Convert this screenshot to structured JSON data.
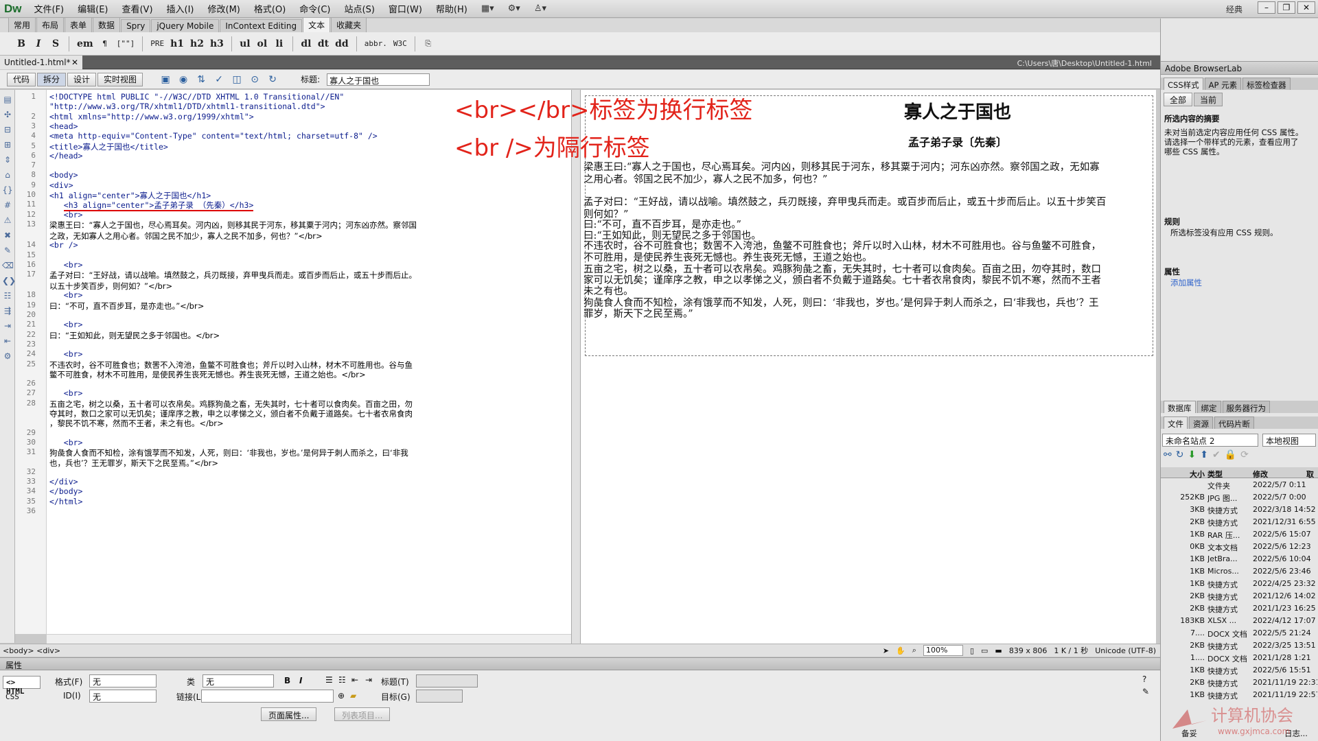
{
  "app": {
    "logo": "Dw",
    "layout": "经典",
    "menus": [
      "文件(F)",
      "编辑(E)",
      "查看(V)",
      "插入(I)",
      "修改(M)",
      "格式(O)",
      "命令(C)",
      "站点(S)",
      "窗口(W)",
      "帮助(H)"
    ]
  },
  "insert_tabs": [
    "常用",
    "布局",
    "表单",
    "数据",
    "Spry",
    "jQuery Mobile",
    "InContext Editing",
    "文本",
    "收藏夹"
  ],
  "format_buttons": [
    "B",
    "I",
    "S",
    "em",
    "¶",
    "[\"\"]",
    "PRE",
    "h1",
    "h2",
    "h3",
    "ul",
    "ol",
    "li",
    "dl",
    "dt",
    "dd",
    "abbr.",
    "W3C",
    "⎘"
  ],
  "document": {
    "tab": "Untitled-1.html*",
    "path": "C:\\Users\\唐\\Desktop\\Untitled-1.html",
    "views": [
      "代码",
      "拆分",
      "设计",
      "实时视图"
    ],
    "title_label": "标题:",
    "title_value": "寡人之于国也"
  },
  "code_lines": [
    {
      "n": "1",
      "t": "<!DOCTYPE html PUBLIC \"-//W3C//DTD XHTML 1.0 Transitional//EN\""
    },
    {
      "n": "",
      "t": "\"http://www.w3.org/TR/xhtml1/DTD/xhtml1-transitional.dtd\">"
    },
    {
      "n": "2",
      "t": "<html xmlns=\"http://www.w3.org/1999/xhtml\">"
    },
    {
      "n": "3",
      "t": "<head>"
    },
    {
      "n": "4",
      "t": "<meta http-equiv=\"Content-Type\" content=\"text/html; charset=utf-8\" />"
    },
    {
      "n": "5",
      "t": "<title>寡人之于国也</title>"
    },
    {
      "n": "6",
      "t": "</head>"
    },
    {
      "n": "7",
      "t": ""
    },
    {
      "n": "8",
      "t": "<body>"
    },
    {
      "n": "9",
      "t": "<div>"
    },
    {
      "n": "10",
      "t": "<h1 align=\"center\">寡人之于国也</h1>"
    },
    {
      "n": "11",
      "t": "<h3 align=\"center\">孟子弟子录 （先秦）</h3>"
    },
    {
      "n": "12",
      "t": "   <br>"
    },
    {
      "n": "13",
      "t": "梁惠王曰：“寡人之于国也，尽心焉耳矣。河内凶，则移其民于河东，移其粟于河内；河东凶亦然。察邻国"
    },
    {
      "n": "",
      "t": "之政，无如寡人之用心者。邻国之民不加少，寡人之民不加多，何也？”</br>"
    },
    {
      "n": "14",
      "t": "<br />"
    },
    {
      "n": "15",
      "t": ""
    },
    {
      "n": "16",
      "t": "   <br>"
    },
    {
      "n": "17",
      "t": "孟子对曰：“王好战，请以战喻。填然鼓之，兵刃既接，弃甲曳兵而走。或百步而后止，或五十步而后止。"
    },
    {
      "n": "",
      "t": "以五十步笑百步，则何如？”</br>"
    },
    {
      "n": "18",
      "t": "   <br>"
    },
    {
      "n": "19",
      "t": "曰：“不可，直不百步耳，是亦走也。”</br>"
    },
    {
      "n": "20",
      "t": ""
    },
    {
      "n": "21",
      "t": "   <br>"
    },
    {
      "n": "22",
      "t": "曰：“王如知此，则无望民之多于邻国也。</br>"
    },
    {
      "n": "23",
      "t": ""
    },
    {
      "n": "24",
      "t": "   <br>"
    },
    {
      "n": "25",
      "t": "不违农时，谷不可胜食也；数罟不入洿池，鱼鳖不可胜食也；斧斤以时入山林，材木不可胜用也。谷与鱼"
    },
    {
      "n": "",
      "t": "鳖不可胜食，材木不可胜用，是使民养生丧死无憾也。养生丧死无憾，王道之始也。</br>"
    },
    {
      "n": "26",
      "t": ""
    },
    {
      "n": "27",
      "t": "   <br>"
    },
    {
      "n": "28",
      "t": "五亩之宅，树之以桑，五十者可以衣帛矣。鸡豚狗彘之畜，无失其时，七十者可以食肉矣。百亩之田，勿"
    },
    {
      "n": "",
      "t": "夺其时，数口之家可以无饥矣；谨庠序之教，申之以孝悌之义，颁白者不负戴于道路矣。七十者衣帛食肉"
    },
    {
      "n": "",
      "t": "，黎民不饥不寒，然而不王者，未之有也。</br>"
    },
    {
      "n": "29",
      "t": ""
    },
    {
      "n": "30",
      "t": "   <br>"
    },
    {
      "n": "31",
      "t": "狗彘食人食而不知检，涂有饿莩而不知发，人死，则曰：‘非我也，岁也。’是何异于刺人而杀之，曰‘非我"
    },
    {
      "n": "",
      "t": "也，兵也’？王无罪岁，斯天下之民至焉。”</br>"
    },
    {
      "n": "32",
      "t": ""
    },
    {
      "n": "33",
      "t": "</div>"
    },
    {
      "n": "34",
      "t": "</body>"
    },
    {
      "n": "35",
      "t": "</html>"
    },
    {
      "n": "36",
      "t": ""
    }
  ],
  "annotations": {
    "line1": "<br></br>标签为换行标签",
    "line2": "<br />为隔行标签"
  },
  "design": {
    "h1": "寡人之于国也",
    "h3": "孟子弟子录〔先秦〕",
    "paras": [
      "梁惠王曰:“寡人之于国也，尽心焉耳矣。河内凶，则移其民于河东，移其粟于河内；河东凶亦然。察邻国之政，无如寡",
      "之用心者。邻国之民不加少，寡人之民不加多，何也？”",
      "孟子对曰：“王好战，请以战喻。填然鼓之，兵刃既接，弃甲曳兵而走。或百步而后止，或五十步而后止。以五十步笑百",
      "则何如？”",
      "曰:“不可，直不百步耳，是亦走也。”",
      "曰:“王如知此，则无望民之多于邻国也。",
      "不违农时，谷不可胜食也；数罟不入洿池，鱼鳖不可胜食也；斧斤以时入山林，材木不可胜用也。谷与鱼鳖不可胜食，",
      "不可胜用，是使民养生丧死无憾也。养生丧死无憾，王道之始也。",
      "五亩之宅，树之以桑，五十者可以衣帛矣。鸡豚狗彘之畜，无失其时，七十者可以食肉矣。百亩之田，勿夺其时，数口",
      "家可以无饥矣；谨庠序之教，申之以孝悌之义，颁白者不负戴于道路矣。七十者衣帛食肉，黎民不饥不寒，然而不王者",
      "未之有也。",
      "狗彘食人食而不知检，涂有饿莩而不知发，人死，则曰：‘非我也，岁也。’是何异于刺人而杀之，曰‘非我也，兵也’？王",
      "罪岁，斯天下之民至焉。”"
    ]
  },
  "status": {
    "tags": "<body> <div>",
    "zoom": "100%",
    "size": "839 x 806",
    "speed": "1 K / 1 秒",
    "encoding": "Unicode (UTF-8)"
  },
  "properties": {
    "header": "属性",
    "html_tab": "<> HTML",
    "css_tab": "CSS",
    "format_label": "格式(F)",
    "format_value": "无",
    "class_label": "类",
    "class_value": "无",
    "id_label": "ID(I)",
    "id_value": "无",
    "link_label": "链接(L)",
    "title_label": "标题(T)",
    "target_label": "目标(G)",
    "page_props": "页面属性...",
    "list_item": "列表项目..."
  },
  "right_panel": {
    "browserlab": "Adobe BrowserLab",
    "css_tabs": [
      "CSS样式",
      "AP 元素",
      "标签检查器"
    ],
    "all_btn": "全部",
    "current_btn": "当前",
    "summary_title": "所选内容的摘要",
    "summary_text": [
      "未对当前选定内容应用任何 CSS 属性。",
      "请选择一个带样式的元素，查看应用了",
      "哪些 CSS 属性。"
    ],
    "rules_title": "规则",
    "rules_text": "所选标签没有应用 CSS 规则。",
    "attr_title": "属性",
    "add_attr": "添加属性",
    "db_tabs": [
      "数据库",
      "绑定",
      "服务器行为"
    ],
    "file_tabs": [
      "文件",
      "资源",
      "代码片断"
    ],
    "site_select": "未命名站点 2",
    "view_select": "本地视图",
    "file_cols": [
      "大小",
      "类型",
      "修改",
      "取"
    ],
    "files": [
      {
        "size": "",
        "type": "文件夹",
        "date": "2022/5/7 0:11"
      },
      {
        "size": "252KB",
        "type": "JPG 图...",
        "date": "2022/5/7 0:00"
      },
      {
        "size": "3KB",
        "type": "快捷方式",
        "date": "2022/3/18 14:52"
      },
      {
        "size": "2KB",
        "type": "快捷方式",
        "date": "2021/12/31 6:55"
      },
      {
        "size": "1KB",
        "type": "RAR 压...",
        "date": "2022/5/6 15:07"
      },
      {
        "size": "0KB",
        "type": "文本文档",
        "date": "2022/5/6 12:23"
      },
      {
        "size": "1KB",
        "type": "JetBra...",
        "date": "2022/5/6 10:04"
      },
      {
        "size": "1KB",
        "type": "Micros...",
        "date": "2022/5/6 23:46"
      },
      {
        "size": "1KB",
        "type": "快捷方式",
        "date": "2022/4/25 23:32"
      },
      {
        "size": "2KB",
        "type": "快捷方式",
        "date": "2021/12/6 14:02"
      },
      {
        "size": "2KB",
        "type": "快捷方式",
        "date": "2021/1/23 16:25"
      },
      {
        "size": "183KB",
        "type": "XLSX ...",
        "date": "2022/4/12 17:07"
      },
      {
        "size": "7....",
        "type": "DOCX 文档",
        "date": "2022/5/5 21:24"
      },
      {
        "size": "2KB",
        "type": "快捷方式",
        "date": "2022/3/25 13:51"
      },
      {
        "size": "1....",
        "type": "DOCX 文档",
        "date": "2021/1/28 1:21"
      },
      {
        "size": "1KB",
        "type": "快捷方式",
        "date": "2022/5/6 15:51"
      },
      {
        "size": "2KB",
        "type": "快捷方式",
        "date": "2021/11/19 22:31"
      },
      {
        "size": "1KB",
        "type": "快捷方式",
        "date": "2021/11/19 22:57"
      }
    ],
    "log_btn": "日志...",
    "ready": "备妥"
  },
  "watermark": {
    "text": "计算机协会",
    "url": "www.gxjmca.com"
  },
  "colors": {
    "annotation": "#e2231a",
    "code_tag": "#1d2fa8",
    "doc_tab_bar": "#5d5d5d"
  }
}
